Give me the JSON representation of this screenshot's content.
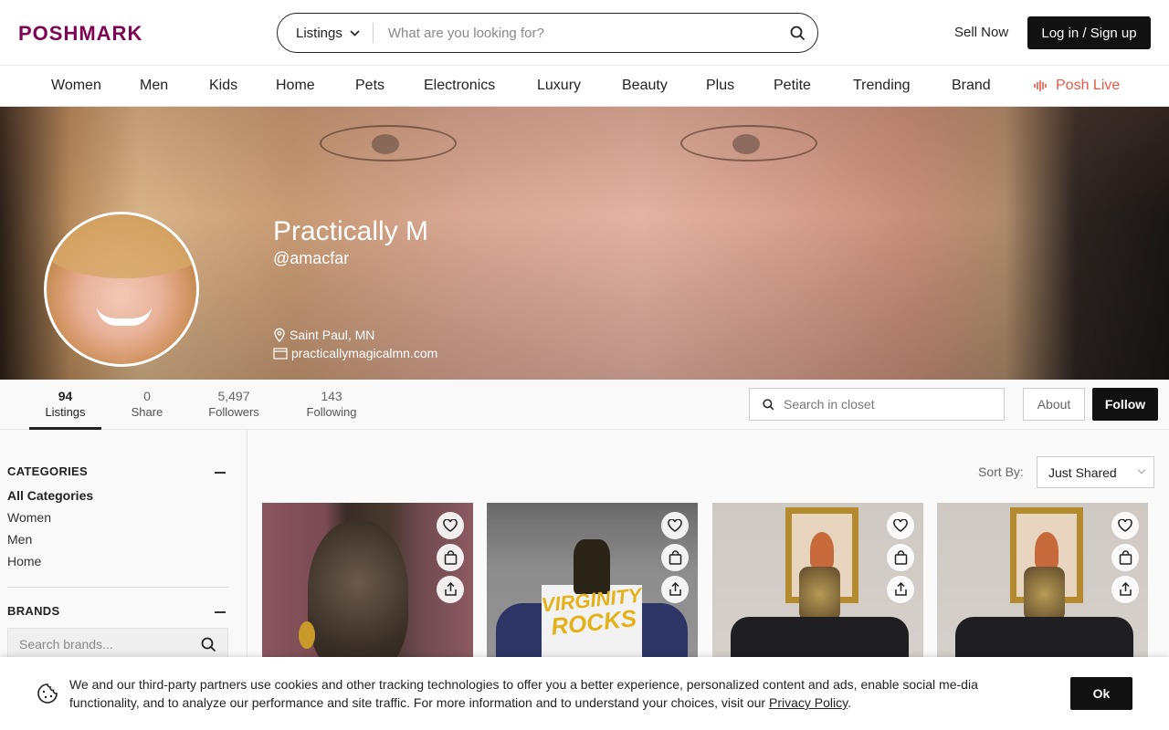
{
  "header": {
    "logo": "POSHMARK",
    "search_category": "Listings",
    "search_placeholder": "What are you looking for?",
    "sell_now": "Sell Now",
    "login": "Log in / Sign up"
  },
  "nav": {
    "items": [
      "Women",
      "Men",
      "Kids",
      "Home",
      "Pets",
      "Electronics",
      "Luxury",
      "Beauty",
      "Plus",
      "Petite",
      "Trending",
      "Brand"
    ],
    "live": "Posh Live",
    "live_color": "#e45a4a"
  },
  "profile": {
    "name": "Practically M",
    "handle": "@amacfar",
    "location": "Saint Paul, MN",
    "website": "practicallymagicalmn.com"
  },
  "stats": {
    "listings": {
      "value": "94",
      "label": "Listings"
    },
    "shares": {
      "value": "0",
      "label": "Share"
    },
    "followers": {
      "value": "5,497",
      "label": "Followers"
    },
    "following": {
      "value": "143",
      "label": "Following"
    },
    "closet_search_placeholder": "Search in closet",
    "about": "About",
    "follow": "Follow"
  },
  "sidebar": {
    "categories_heading": "CATEGORIES",
    "categories": [
      "All Categories",
      "Women",
      "Men",
      "Home"
    ],
    "brands_heading": "BRANDS",
    "brand_search_placeholder": "Search brands..."
  },
  "main": {
    "sort_label": "Sort By:",
    "sort_value": "Just Shared",
    "listing_graphic_text": [
      "VIRGINITY",
      "ROCKS"
    ]
  },
  "cookie": {
    "text": "We and our third-party partners use cookies and other tracking technologies to offer you a better experience, personalized content and ads, enable social me-dia functionality, and to analyze our performance and site traffic. For more information and to understand your choices, visit our ",
    "link": "Privacy Policy",
    "suffix": ".",
    "ok": "Ok"
  },
  "colors": {
    "brand": "#7f0353",
    "button_dark": "#111111"
  }
}
